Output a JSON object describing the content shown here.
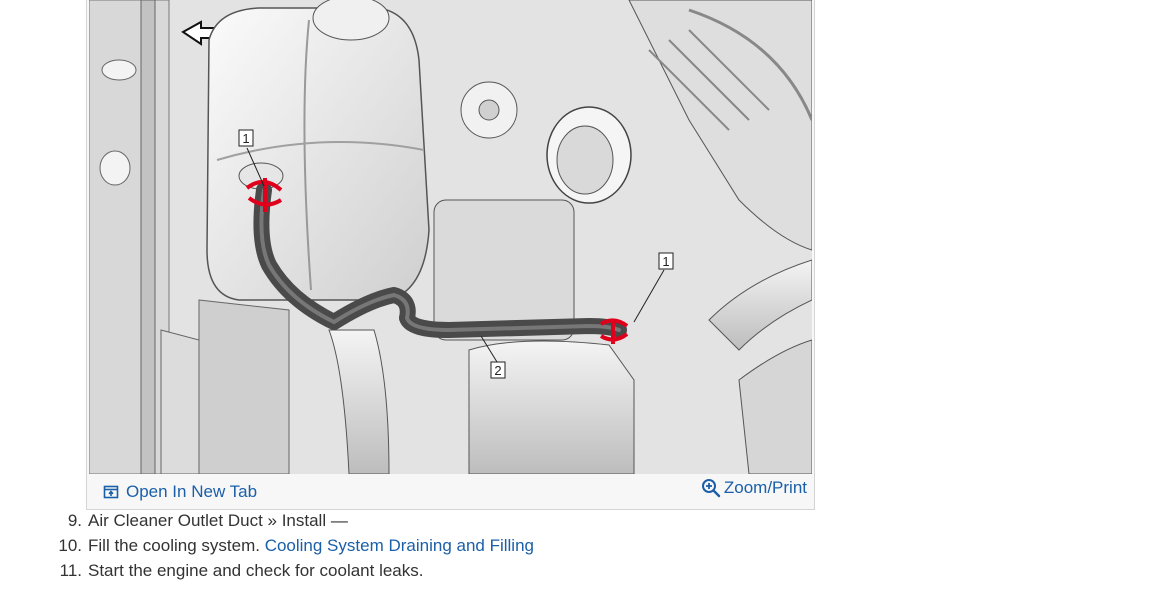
{
  "figure": {
    "callouts": {
      "first": "1",
      "second": "1",
      "third": "2"
    },
    "open_new_tab_label": "Open In New Tab",
    "zoom_print_label": "Zoom/Print",
    "icons": {
      "open_tab": "open-new-tab-icon",
      "zoom": "zoom-in-icon"
    },
    "colors": {
      "link": "#1a5fa8",
      "clamp_highlight": "#e0001b"
    }
  },
  "steps": [
    {
      "number": "9.",
      "text": "Air Cleaner Outlet Duct » Install —",
      "link": ""
    },
    {
      "number": "10.",
      "text": "Fill the cooling system. ",
      "link": "Cooling System Draining and Filling"
    },
    {
      "number": "11.",
      "text": "Start the engine and check for coolant leaks.",
      "link": ""
    }
  ]
}
